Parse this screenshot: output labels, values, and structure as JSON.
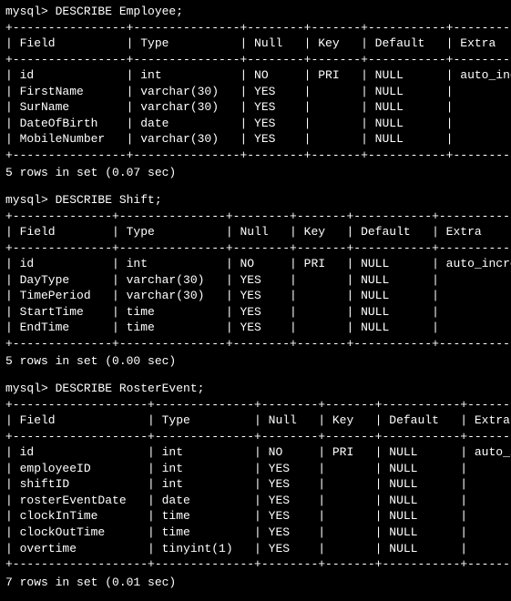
{
  "prompt_prefix": "mysql> ",
  "headers": [
    "Field",
    "Type",
    "Null",
    "Key",
    "Default",
    "Extra"
  ],
  "blocks": [
    {
      "command": "DESCRIBE Employee;",
      "widths": [
        14,
        13,
        6,
        5,
        9,
        16
      ],
      "rows": [
        {
          "Field": "id",
          "Type": "int",
          "Null": "NO",
          "Key": "PRI",
          "Default": "NULL",
          "Extra": "auto_increment"
        },
        {
          "Field": "FirstName",
          "Type": "varchar(30)",
          "Null": "YES",
          "Key": "",
          "Default": "NULL",
          "Extra": ""
        },
        {
          "Field": "SurName",
          "Type": "varchar(30)",
          "Null": "YES",
          "Key": "",
          "Default": "NULL",
          "Extra": ""
        },
        {
          "Field": "DateOfBirth",
          "Type": "date",
          "Null": "YES",
          "Key": "",
          "Default": "NULL",
          "Extra": ""
        },
        {
          "Field": "MobileNumber",
          "Type": "varchar(30)",
          "Null": "YES",
          "Key": "",
          "Default": "NULL",
          "Extra": ""
        }
      ],
      "footer": "5 rows in set (0.07 sec)"
    },
    {
      "command": "DESCRIBE Shift;",
      "widths": [
        12,
        13,
        6,
        5,
        9,
        16
      ],
      "rows": [
        {
          "Field": "id",
          "Type": "int",
          "Null": "NO",
          "Key": "PRI",
          "Default": "NULL",
          "Extra": "auto_increment"
        },
        {
          "Field": "DayType",
          "Type": "varchar(30)",
          "Null": "YES",
          "Key": "",
          "Default": "NULL",
          "Extra": ""
        },
        {
          "Field": "TimePeriod",
          "Type": "varchar(30)",
          "Null": "YES",
          "Key": "",
          "Default": "NULL",
          "Extra": ""
        },
        {
          "Field": "StartTime",
          "Type": "time",
          "Null": "YES",
          "Key": "",
          "Default": "NULL",
          "Extra": ""
        },
        {
          "Field": "EndTime",
          "Type": "time",
          "Null": "YES",
          "Key": "",
          "Default": "NULL",
          "Extra": ""
        }
      ],
      "footer": "5 rows in set (0.00 sec)"
    },
    {
      "command": "DESCRIBE RosterEvent;",
      "widths": [
        17,
        12,
        6,
        5,
        9,
        16
      ],
      "rows": [
        {
          "Field": "id",
          "Type": "int",
          "Null": "NO",
          "Key": "PRI",
          "Default": "NULL",
          "Extra": "auto_increment"
        },
        {
          "Field": "employeeID",
          "Type": "int",
          "Null": "YES",
          "Key": "",
          "Default": "NULL",
          "Extra": ""
        },
        {
          "Field": "shiftID",
          "Type": "int",
          "Null": "YES",
          "Key": "",
          "Default": "NULL",
          "Extra": ""
        },
        {
          "Field": "rosterEventDate",
          "Type": "date",
          "Null": "YES",
          "Key": "",
          "Default": "NULL",
          "Extra": ""
        },
        {
          "Field": "clockInTime",
          "Type": "time",
          "Null": "YES",
          "Key": "",
          "Default": "NULL",
          "Extra": ""
        },
        {
          "Field": "clockOutTime",
          "Type": "time",
          "Null": "YES",
          "Key": "",
          "Default": "NULL",
          "Extra": ""
        },
        {
          "Field": "overtime",
          "Type": "tinyint(1)",
          "Null": "YES",
          "Key": "",
          "Default": "NULL",
          "Extra": ""
        }
      ],
      "footer": "7 rows in set (0.01 sec)"
    }
  ]
}
